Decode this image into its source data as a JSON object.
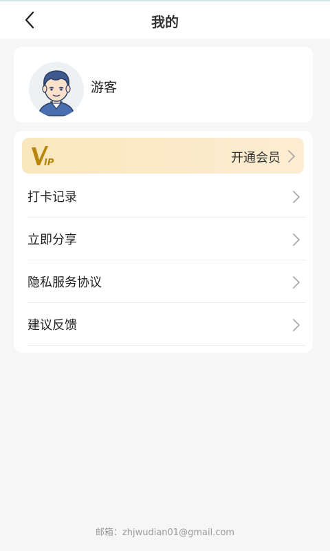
{
  "header": {
    "title": "我的"
  },
  "profile": {
    "username": "游客"
  },
  "vip": {
    "logo_text": "VIP",
    "label": "开通会员"
  },
  "menu": {
    "items": [
      {
        "label": "打卡记录"
      },
      {
        "label": "立即分享"
      },
      {
        "label": "隐私服务协议"
      },
      {
        "label": "建议反馈"
      }
    ]
  },
  "footer": {
    "email_label": "邮箱：",
    "email": "zhjwudian01@gmail.com"
  },
  "colors": {
    "vip_gradient_start": "#fbe7bd",
    "vip_gradient_end": "#fcedd2",
    "vip_logo": "#b8860b",
    "background": "#f6f6f6"
  },
  "icons": [
    "back-arrow-icon",
    "vip-logo-icon",
    "chevron-right-icon"
  ]
}
